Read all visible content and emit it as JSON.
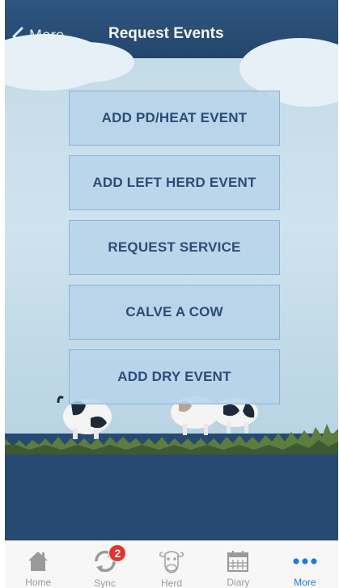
{
  "navbar": {
    "back_label": "More",
    "title": "Request Events",
    "background_color": "#2f5680"
  },
  "actions": [
    {
      "label": "ADD PD/HEAT EVENT"
    },
    {
      "label": "ADD LEFT HERD EVENT"
    },
    {
      "label": "REQUEST SERVICE"
    },
    {
      "label": "CALVE A COW"
    },
    {
      "label": "ADD DRY EVENT"
    }
  ],
  "tabbar": {
    "tabs": [
      {
        "label": "Home",
        "icon": "home-icon",
        "active": false
      },
      {
        "label": "Sync",
        "icon": "sync-icon",
        "active": false,
        "badge": "2"
      },
      {
        "label": "Herd",
        "icon": "cow-face-icon",
        "active": false
      },
      {
        "label": "Diary",
        "icon": "calendar-icon",
        "active": false
      },
      {
        "label": "More",
        "icon": "more-dots-icon",
        "active": true
      }
    ],
    "active_color": "#1f7ae0",
    "badge_color": "#e5342a"
  }
}
